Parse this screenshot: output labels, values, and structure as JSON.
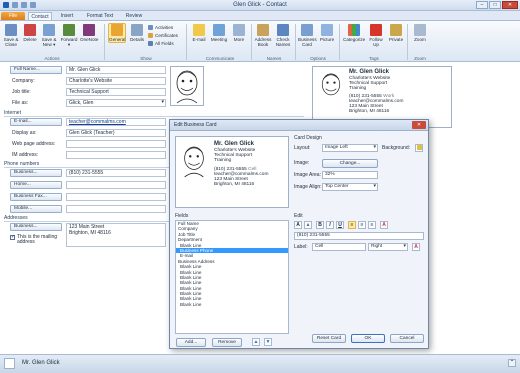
{
  "window": {
    "title": "Glen Glick  -  Contact",
    "min": "–",
    "max": "□",
    "close": "✕"
  },
  "tabs": {
    "file": "File",
    "contact": "Contact",
    "insert": "Insert",
    "format_text": "Format Text",
    "review": "Review"
  },
  "ribbon": {
    "save_close": "Save & Close",
    "delete": "Delete",
    "save_new": "Save & New ▾",
    "forward": "Forward ▾",
    "onenote": "OneNote",
    "general": "General",
    "details": "Details",
    "activities": "Activities",
    "certificates": "Certificates",
    "all_fields": "All Fields",
    "email": "E-mail",
    "meeting": "Meeting",
    "more": "More",
    "address_book": "Address Book",
    "check_names": "Check Names",
    "business_card": "Business Card",
    "picture": "Picture",
    "categorize": "Categorize",
    "follow_up": "Follow Up",
    "private": "Private",
    "zoom": "Zoom",
    "groups": {
      "actions": "Actions",
      "show": "Show",
      "communicate": "Communicate",
      "names": "Names",
      "options": "Options",
      "tags": "Tags",
      "zoom": "Zoom"
    }
  },
  "form": {
    "full_name_btn": "Full Name...",
    "full_name": "Mr. Glen Glick",
    "company_label": "Company:",
    "company": "Charlotte's Website",
    "job_title_label": "Job title:",
    "job_title": "Technical Support",
    "file_as_label": "File as:",
    "file_as": "Glick, Glen",
    "internet": "Internet",
    "email_btn": "E-mail...",
    "email": "teacher@commalms.com",
    "display_as_label": "Display as:",
    "display_as": "Glen Glick (Teacher)",
    "web_label": "Web page address:",
    "im_label": "IM address:",
    "phone_numbers": "Phone numbers",
    "business_btn": "Business...",
    "business_phone": "(810) 231-5555",
    "home_btn": "Home...",
    "business_fax_btn": "Business Fax...",
    "mobile_btn": "Mobile...",
    "addresses": "Addresses",
    "address_business_btn": "Business...",
    "address_line1": "123 Main Street",
    "address_line2": "Brighton, MI 48116",
    "mailing_check": "This is the mailing address"
  },
  "card_preview": {
    "name": "Mr. Glen Glick",
    "company": "Charlotte's Website",
    "title": "Technical Support",
    "training": "Training",
    "phone": "(810) 231-5555",
    "phone_label": "Work",
    "email": "teacher@commalms.com",
    "street": "123 Main Street",
    "city": "Brighton, MI 48116"
  },
  "dialog": {
    "title": "Edit Business Card",
    "close": "✕",
    "card": {
      "name": "Mr. Glen Glick",
      "company": "Charlotte's Website",
      "title": "Technical Support",
      "training": "Training",
      "phone": "(810) 231-5555",
      "phone_label": "Cell",
      "email": "teacher@commalms.com",
      "street": "123 Main Street",
      "city": "Brighton, MI 48116"
    },
    "card_design": "Card Design",
    "layout_label": "Layout:",
    "layout_value": "Image Left",
    "background_label": "Background:",
    "image_label": "Image:",
    "change_btn": "Change...",
    "image_area_label": "Image Area:",
    "image_area_value": "32%",
    "image_align_label": "Image Align:",
    "image_align_value": "Top Center",
    "fields_label": "Fields",
    "fields": [
      "Full Name",
      "Company",
      "Job Title",
      "Department",
      "Blank Line",
      "Business Phone",
      "E-mail",
      "Business Address",
      "Blank Line",
      "Blank Line",
      "Blank Line",
      "Blank Line",
      "Blank Line",
      "Blank Line",
      "Blank Line",
      "Blank Line"
    ],
    "selected_field": "Business Phone",
    "add_btn": "Add...",
    "remove_btn": "Remove",
    "up": "▲",
    "down": "▼",
    "edit_label": "Edit",
    "edit_value": "(810) 231-5555",
    "label_label": "Label:",
    "label_value": "Cell",
    "label_pos": "Right",
    "reset_btn": "Reset Card",
    "ok_btn": "OK",
    "cancel_btn": "Cancel"
  },
  "status": {
    "name": "Mr. Glen Glick"
  }
}
